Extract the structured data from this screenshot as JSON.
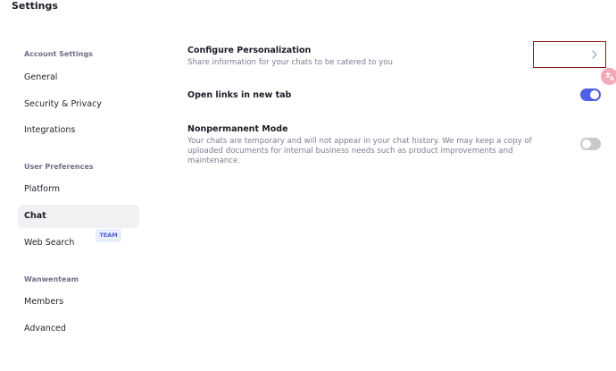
{
  "page": {
    "title": "Settings"
  },
  "sidebar": {
    "sections": [
      {
        "header": "Account Settings",
        "items": [
          {
            "label": "General"
          },
          {
            "label": "Security & Privacy"
          },
          {
            "label": "Integrations"
          }
        ]
      },
      {
        "header": "User Preferences",
        "items": [
          {
            "label": "Platform"
          },
          {
            "label": "Chat",
            "active": true
          },
          {
            "label": "Web Search"
          }
        ]
      },
      {
        "header": "Wanwenteam",
        "badge": "TEAM",
        "items": [
          {
            "label": "Members"
          },
          {
            "label": "Advanced"
          }
        ]
      }
    ]
  },
  "settings": {
    "personalization": {
      "title": "Configure Personalization",
      "description": "Share information for your chats to be catered to you"
    },
    "open_links": {
      "title": "Open links in new tab",
      "enabled": true
    },
    "nonpermanent": {
      "title": "Nonpermanent Mode",
      "description_lines": [
        "Your chats are temporary and will not appear in your chat history. We may keep a copy of",
        "uploaded documents for internal business needs such as product improvements and",
        "maintenance."
      ],
      "enabled": false
    }
  },
  "colors": {
    "accent": "#4f5fe4",
    "highlight_border": "#8b1a1a",
    "floating_icon": "#f3a7b7"
  },
  "icons": {
    "chevron": "chevron-right-icon",
    "floating": "translate-icon"
  }
}
